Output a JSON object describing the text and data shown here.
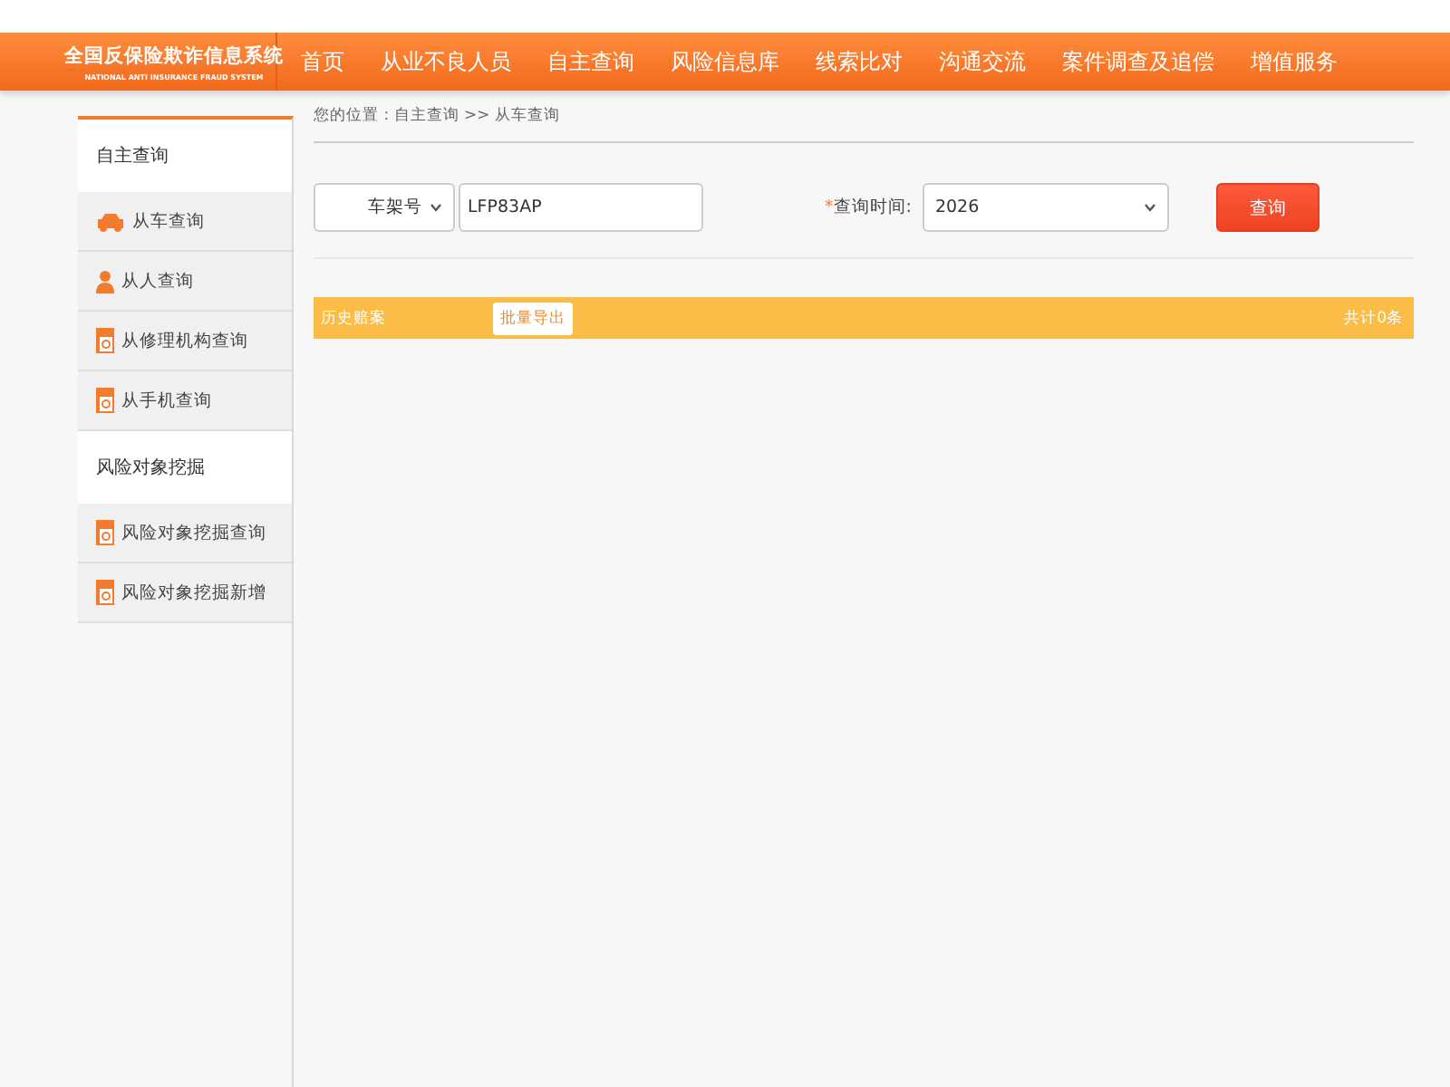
{
  "logo": {
    "title": "全国反保险欺诈信息系统",
    "subtitle": "NATIONAL ANTI INSURANCE FRAUD SYSTEM"
  },
  "nav": [
    "首页",
    "从业不良人员",
    "自主查询",
    "风险信息库",
    "线索比对",
    "沟通交流",
    "案件调查及追偿",
    "增值服务"
  ],
  "sidebar": [
    {
      "title": "自主查询",
      "items": [
        {
          "label": "从车查询",
          "kind": "car"
        },
        {
          "label": "从人查询",
          "kind": "person"
        },
        {
          "label": "从修理机构查询",
          "kind": "calendar"
        },
        {
          "label": "从手机查询",
          "kind": "calendar"
        }
      ]
    },
    {
      "title": "风险对象挖掘",
      "items": [
        {
          "label": "风险对象挖掘查询",
          "kind": "calendar"
        },
        {
          "label": "风险对象挖掘新增",
          "kind": "calendar"
        }
      ]
    }
  ],
  "breadcrumb": "您的位置 : 自主查询 >> 从车查询",
  "search": {
    "type_select": "车架号",
    "query_value": "LFP83AP",
    "time_label": "查询时间:",
    "required_mark": "*",
    "time_select": "2026",
    "button": "查询"
  },
  "results_bar": {
    "title": "历史赔案",
    "export_button": "批量导出",
    "total": "共计0条"
  }
}
